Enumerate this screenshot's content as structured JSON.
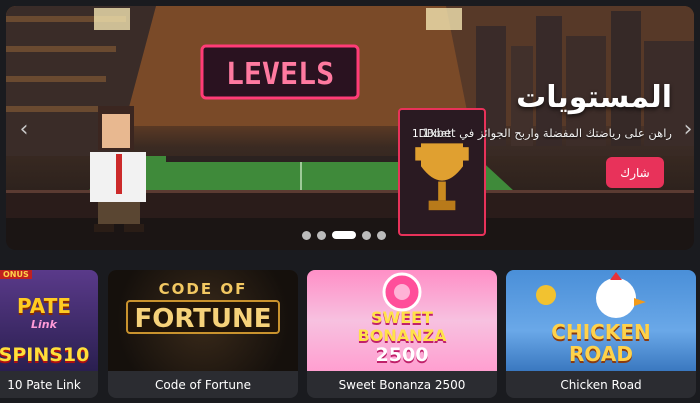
{
  "hero": {
    "title": "المستويات",
    "subtitle": "راهن على رياضتك المفضلة واربح الجوائز في 1xbet",
    "share_label": "شارك",
    "sign_text": "LEVELS",
    "trophy_caption": "1DBbet",
    "prev_arrow": "‹",
    "next_arrow": "›",
    "slide_count": 6,
    "active_slide": 3
  },
  "games": [
    {
      "name": "10 Pate Link",
      "art_top": "PATE",
      "art_sub": "Link",
      "art_bottom": "SPINS10",
      "badge": "ONUS"
    },
    {
      "name": "Code of Fortune",
      "art_top": "CODE OF",
      "art_bottom": "FORTUNE"
    },
    {
      "name": "Sweet Bonanza 2500",
      "art_top": "SWEET",
      "art_mid": "BONANZA",
      "art_bottom": "2500"
    },
    {
      "name": "Chicken Road",
      "art_top": "CHICKEN",
      "art_bottom": "ROAD"
    }
  ],
  "colors": {
    "accent": "#e8325a",
    "background": "#1a1b1f",
    "card": "#2b2c31",
    "fortune_gold": "#e9b54a",
    "bonanza_pink": "#ff6fb5",
    "chicken_blue": "#4a8fd8"
  },
  "icons": {
    "prev": "chevron-left-icon",
    "next": "chevron-right-icon"
  }
}
